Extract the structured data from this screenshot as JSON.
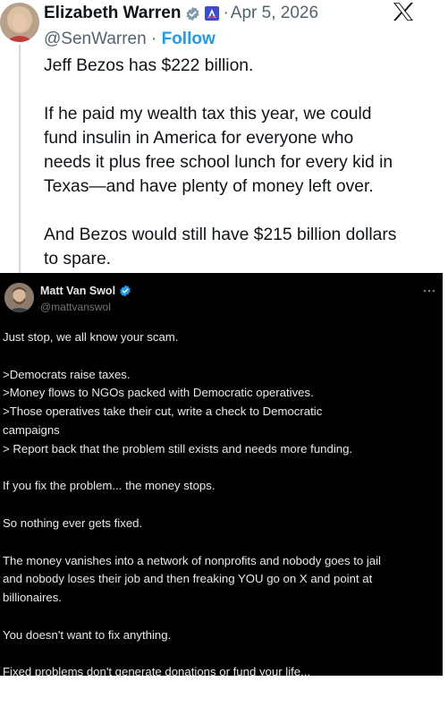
{
  "top_tweet": {
    "author_name": "Elizabeth Warren",
    "date": "Apr 5, 2026",
    "handle": "@SenWarren",
    "separator": "·",
    "follow_label": "Follow",
    "text": {
      "p1": "Jeff Bezos has $222 billion.",
      "p2_l1": "If he paid my wealth tax this year, we could",
      "p2_l2": "fund insulin in America for everyone who",
      "p2_l3": "needs it plus free school lunch for every kid in",
      "p2_l4": "Texas—and have plenty of money left over.",
      "p3_l1": "And Bezos would still have $215 billion dollars",
      "p3_l2": "to spare."
    },
    "icons": {
      "verified": "verified-badge-icon",
      "government": "government-badge-icon",
      "platform": "x-logo-icon"
    }
  },
  "quoted_post": {
    "author_name": "Matt Van Swol",
    "handle": "@mattvanswol",
    "lines": [
      "Just stop, we all know your scam.",
      "",
      ">Democrats raise taxes.",
      ">Money flows to NGOs packed with Democratic operatives.",
      ">Those operatives take their cut, write a check to Democratic",
      "campaigns",
      "> Report back that the problem still exists and needs more funding.",
      "",
      "If you fix the problem... the money stops.",
      "",
      "So nothing ever gets fixed.",
      "",
      "The money vanishes into a network of nonprofits and nobody goes to jail",
      "and nobody loses their job and then freaking YOU go on X and point at",
      "billionaires.",
      "",
      "You doesn't want to fix anything.",
      "",
      "Fixed problems don't generate donations or fund your life..."
    ]
  },
  "colors": {
    "accent": "#1d9bf0",
    "text_dark": "#0f1419",
    "muted": "#536471",
    "dark_bg": "#000000",
    "dark_text": "#e7e9ea"
  }
}
